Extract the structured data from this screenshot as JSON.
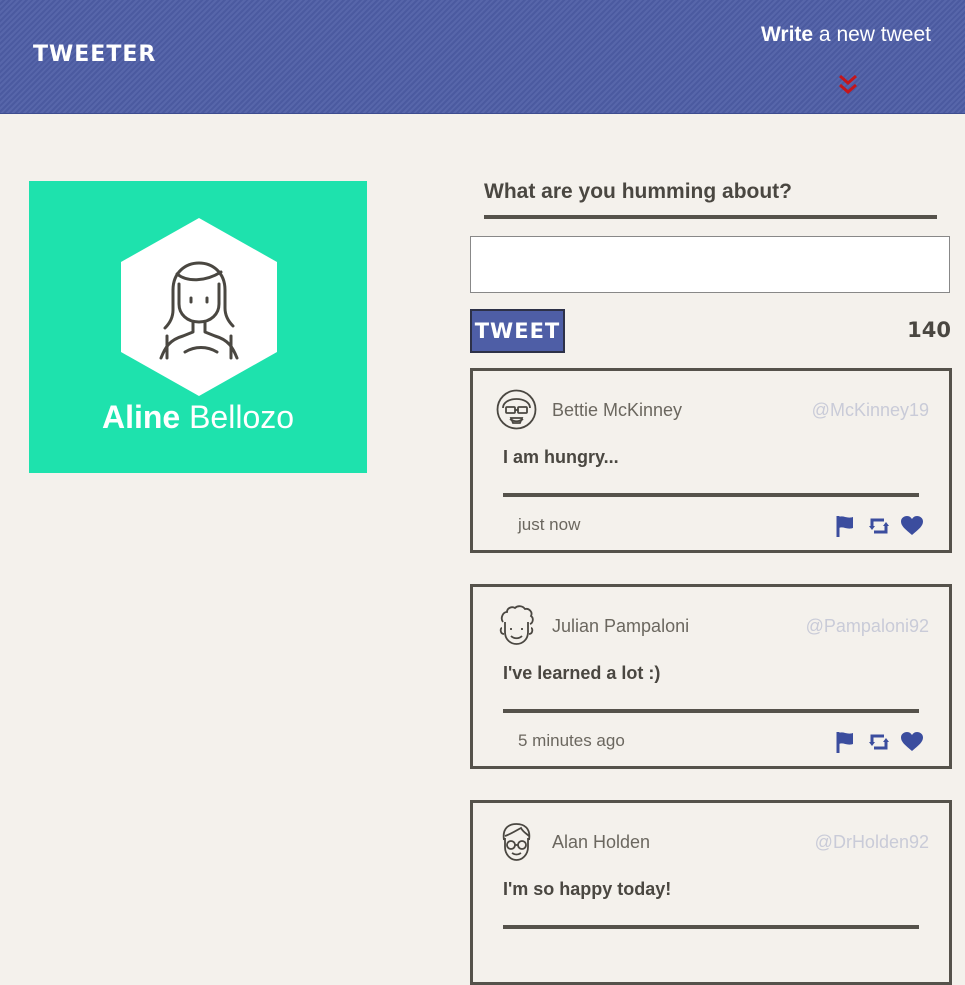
{
  "nav": {
    "brand": "TWEETER",
    "compose_bold": "Write",
    "compose_rest": " a new tweet",
    "chevron_icon": "double-chevron-down-icon",
    "accent": "#c4161c"
  },
  "profile": {
    "first_name": "Aline",
    "last_name": " Bellozo",
    "avatar_icon": "woman-avatar-icon",
    "bg_color": "#1ee2ad"
  },
  "compose": {
    "title": "What are you humming about?",
    "input_value": "",
    "button_label": "TWEET",
    "counter": "140"
  },
  "tweets": [
    {
      "name": "Bettie McKinney",
      "handle": "@McKinney19",
      "content": "I am hungry...",
      "time": "just now",
      "avatar_icon": "woman-glasses-avatar-icon"
    },
    {
      "name": "Julian Pampaloni",
      "handle": "@Pampaloni92",
      "content": "I've learned a lot :)",
      "time": "5 minutes ago",
      "avatar_icon": "curly-hair-avatar-icon"
    },
    {
      "name": "Alan Holden",
      "handle": "@DrHolden92",
      "content": "I'm so happy today!",
      "time": "",
      "avatar_icon": "man-glasses-avatar-icon"
    }
  ],
  "actions": [
    "flag-icon",
    "retweet-icon",
    "heart-icon"
  ],
  "colors": {
    "nav": "#4e5ea6",
    "action": "#3b4d9e",
    "text": "#4a4741"
  }
}
